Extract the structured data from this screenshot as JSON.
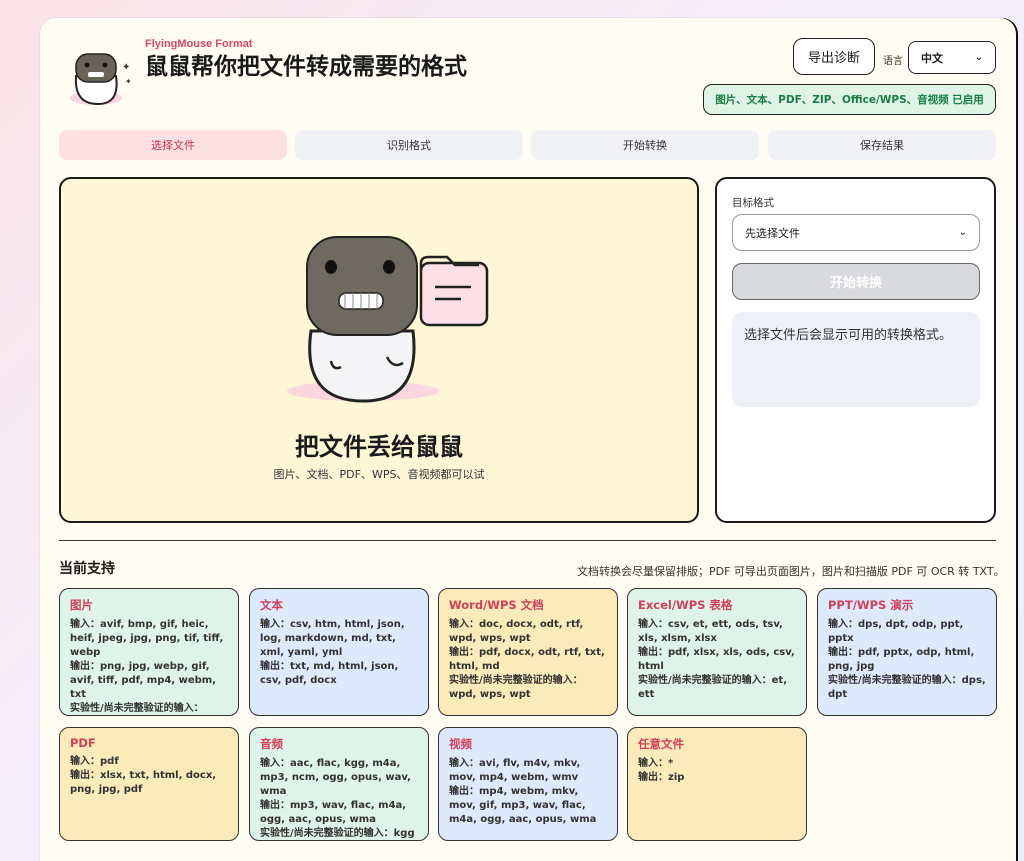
{
  "header": {
    "brand": "FlyingMouse Format",
    "title": "鼠鼠帮你把文件转成需要的格式",
    "export_button": "导出诊断",
    "language_label": "语言",
    "language_value": "中文",
    "enabled_badge": "图片、文本、PDF、ZIP、Office/WPS、音视频 已启用"
  },
  "steps": [
    {
      "label": "选择文件"
    },
    {
      "label": "识别格式"
    },
    {
      "label": "开始转换"
    },
    {
      "label": "保存结果"
    }
  ],
  "dropzone": {
    "title": "把文件丢给鼠鼠",
    "subtitle": "图片、文档、PDF、WPS、音视频都可以试"
  },
  "panel": {
    "target_label": "目标格式",
    "target_value": "先选择文件",
    "start_button": "开始转换",
    "hint": "选择文件后会显示可用的转换格式。"
  },
  "support": {
    "title": "当前支持",
    "note": "文档转换会尽量保留排版；PDF 可导出页面图片，图片和扫描版 PDF 可 OCR 转 TXT。",
    "cards": [
      {
        "title": "图片",
        "lines": [
          "输入：avif, bmp, gif, heic, heif, jpeg, jpg, png, tif, tiff, webp",
          "输出：png, jpg, webp, gif, avif, tiff, pdf, mp4, webm, txt",
          "实验性/尚未完整验证的输入：heic, heif"
        ]
      },
      {
        "title": "文本",
        "lines": [
          "输入：csv, htm, html, json, log, markdown, md, txt, xml, yaml, yml",
          "输出：txt, md, html, json, csv, pdf, docx"
        ]
      },
      {
        "title": "Word/WPS 文档",
        "lines": [
          "输入：doc, docx, odt, rtf, wpd, wps, wpt",
          "输出：pdf, docx, odt, rtf, txt, html, md",
          "实验性/尚未完整验证的输入：wpd, wps, wpt"
        ]
      },
      {
        "title": "Excel/WPS 表格",
        "lines": [
          "输入：csv, et, ett, ods, tsv, xls, xlsm, xlsx",
          "输出：pdf, xlsx, xls, ods, csv, html",
          "实验性/尚未完整验证的输入：et, ett"
        ]
      },
      {
        "title": "PPT/WPS 演示",
        "lines": [
          "输入：dps, dpt, odp, ppt, pptx",
          "输出：pdf, pptx, odp, html, png, jpg",
          "实验性/尚未完整验证的输入：dps, dpt"
        ]
      },
      {
        "title": "PDF",
        "lines": [
          "输入：pdf",
          "输出：xlsx, txt, html, docx, png, jpg, pdf"
        ]
      },
      {
        "title": "音频",
        "lines": [
          "输入：aac, flac, kgg, m4a, mp3, ncm, ogg, opus, wav, wma",
          "输出：mp3, wav, flac, m4a, ogg, aac, opus, wma",
          "实验性/尚未完整验证的输入：kgg"
        ]
      },
      {
        "title": "视频",
        "lines": [
          "输入：avi, flv, m4v, mkv, mov, mp4, webm, wmv",
          "输出：mp4, webm, mkv, mov, gif, mp3, wav, flac, m4a, ogg, aac, opus, wma"
        ]
      },
      {
        "title": "任意文件",
        "lines": [
          "输入：*",
          "输出：zip"
        ]
      }
    ]
  },
  "colors": {
    "accent": "#d9475f",
    "badge_green": "#1a7d43",
    "card_green": "#def4e8",
    "card_blue": "#dde9fc",
    "card_yellow": "#fbeaba"
  }
}
